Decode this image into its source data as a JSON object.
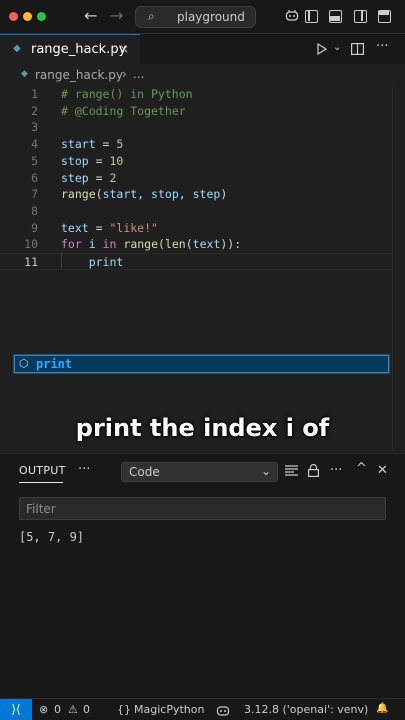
{
  "titlebar": {
    "back_icon": "←",
    "forward_icon": "→",
    "search_icon": "⌕",
    "search_label": "playground"
  },
  "tab": {
    "filename": "range_hack.py",
    "close": "×"
  },
  "breadcrumb": {
    "filename": "range_hack.py",
    "separator": "›",
    "more": "..."
  },
  "editor": {
    "lines": [
      {
        "n": "1",
        "tokens": [
          [
            "cmt",
            "# range() in Python"
          ]
        ]
      },
      {
        "n": "2",
        "tokens": [
          [
            "cmt",
            "# @Coding Together"
          ]
        ]
      },
      {
        "n": "3",
        "tokens": []
      },
      {
        "n": "4",
        "tokens": [
          [
            "var",
            "start"
          ],
          [
            "op",
            " = "
          ],
          [
            "num",
            "5"
          ]
        ]
      },
      {
        "n": "5",
        "tokens": [
          [
            "var",
            "stop"
          ],
          [
            "op",
            " = "
          ],
          [
            "num",
            "10"
          ]
        ]
      },
      {
        "n": "6",
        "tokens": [
          [
            "var",
            "step"
          ],
          [
            "op",
            " = "
          ],
          [
            "num",
            "2"
          ]
        ]
      },
      {
        "n": "7",
        "tokens": [
          [
            "fn",
            "range"
          ],
          [
            "op",
            "("
          ],
          [
            "var",
            "start"
          ],
          [
            "op",
            ", "
          ],
          [
            "var",
            "stop"
          ],
          [
            "op",
            ", "
          ],
          [
            "var",
            "step"
          ],
          [
            "op",
            ")"
          ]
        ]
      },
      {
        "n": "8",
        "tokens": []
      },
      {
        "n": "9",
        "tokens": [
          [
            "var",
            "text"
          ],
          [
            "op",
            " = "
          ],
          [
            "str",
            "\"like!\""
          ]
        ]
      },
      {
        "n": "10",
        "tokens": [
          [
            "kw",
            "for"
          ],
          [
            "op",
            " "
          ],
          [
            "var",
            "i"
          ],
          [
            "op",
            " "
          ],
          [
            "kw",
            "in"
          ],
          [
            "op",
            " "
          ],
          [
            "fn",
            "range"
          ],
          [
            "op",
            "("
          ],
          [
            "fn",
            "len"
          ],
          [
            "op",
            "("
          ],
          [
            "var",
            "text"
          ],
          [
            "op",
            ")):"
          ]
        ]
      },
      {
        "n": "11",
        "tokens": [
          [
            "op",
            "    "
          ],
          [
            "var",
            "print"
          ]
        ]
      }
    ],
    "suggestion": "print"
  },
  "caption": "print the index i of",
  "panel": {
    "tab_label": "OUTPUT",
    "more": "···",
    "channel": "Code",
    "filter_placeholder": "Filter",
    "output_text": "[5, 7, 9]"
  },
  "statusbar": {
    "remote_icon": "⟩⟨",
    "errors_icon": "⊗",
    "errors": "0",
    "warnings_icon": "⚠",
    "warnings": "0",
    "language_icon": "{}",
    "language": "MagicPython",
    "interpreter": "3.12.8 ('openai': venv)",
    "bell_icon": "🔔"
  }
}
